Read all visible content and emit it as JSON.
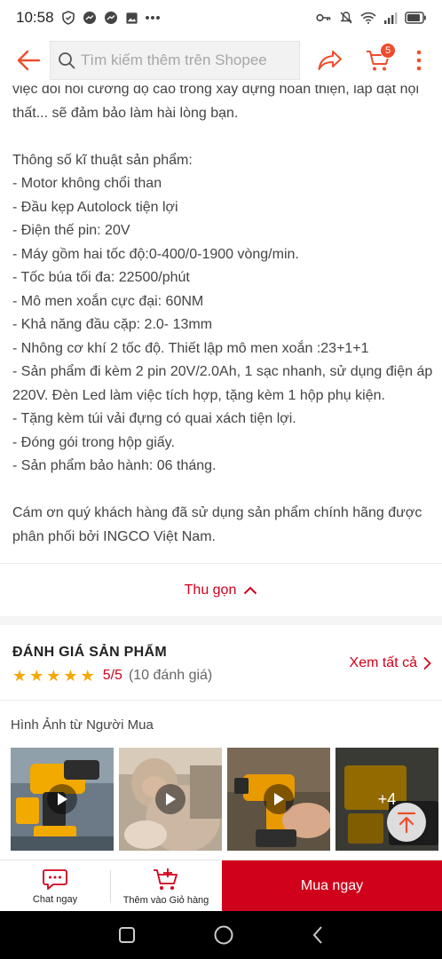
{
  "status_bar": {
    "time": "10:58",
    "left_icons": [
      "shield-icon",
      "messenger-icon",
      "messenger-icon",
      "image-icon",
      "more-dots-icon"
    ],
    "right_icons": [
      "key-icon",
      "mute-icon",
      "wifi-icon",
      "signal-icon",
      "battery-icon"
    ]
  },
  "header": {
    "search_placeholder": "Tìm kiếm thêm trên Shopee",
    "cart_count": "5"
  },
  "description": {
    "lines": [
      "việc đòi hỏi cường độ cao trong xây dựng hoàn thiện, lắp đặt nội thất... sẽ đảm bảo làm hài lòng bạn.",
      "",
      "Thông số kĩ thuật sản phẩm:",
      "- Motor không chổi than",
      "- Đầu kẹp Autolock tiện lợi",
      "- Điện thế pin: 20V",
      "- Máy gồm hai tốc độ:0-400/0-1900 vòng/min.",
      "- Tốc búa tối đa: 22500/phút",
      "- Mô men xoắn cực đại: 60NM",
      "- Khả năng đầu cặp: 2.0- 13mm",
      "- Nhông cơ khí 2 tốc độ. Thiết lập mô men xoắn :23+1+1",
      "- Sản phẩm đi kèm 2 pin 20V/2.0Ah, 1 sạc nhanh, sử dụng điện áp 220V. Đèn Led làm việc tích hợp, tặng kèm 1 hộp phụ kiện.",
      "- Tặng kèm túi vải đựng có quai xách tiện lợi.",
      "- Đóng gói trong hộp giấy.",
      "- Sản phẩm bảo hành: 06 tháng.",
      "",
      "Cám ơn quý khách hàng đã sử dụng sản phẩm chính hãng được phân phối bởi INGCO Việt Nam."
    ],
    "collapse_label": "Thu gọn"
  },
  "reviews": {
    "title": "ĐÁNH GIÁ SẢN PHẨM",
    "rating": "5/5",
    "count_text": "(10 đánh giá)",
    "stars": 5,
    "see_all": "Xem tất cả",
    "buyer_images_title": "Hình Ảnh từ Người Mua",
    "more_count": "+4"
  },
  "bottom_bar": {
    "chat_label": "Chat ngay",
    "add_cart_label": "Thêm vào Giỏ hàng",
    "buy_now_label": "Mua ngay"
  },
  "colors": {
    "accent": "#d0011b",
    "brand": "#ee4d2d",
    "star": "#f6a700"
  }
}
